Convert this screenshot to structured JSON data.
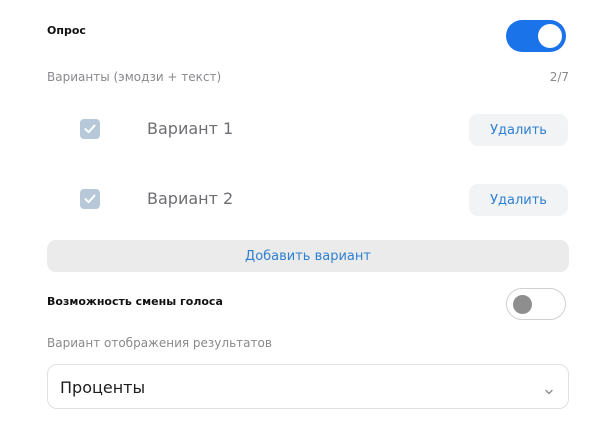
{
  "poll": {
    "title": "Опрос",
    "enabled": true
  },
  "variants": {
    "label": "Варианты (эмодзи + текст)",
    "count": "2/7",
    "items": [
      {
        "emoji": "✅",
        "text": "Вариант 1",
        "delete_label": "Удалить"
      },
      {
        "emoji": "✅",
        "text": "Вариант 2",
        "delete_label": "Удалить"
      }
    ],
    "add_label": "Добавить вариант"
  },
  "vote_change": {
    "label": "Возможность смены голоса",
    "enabled": false
  },
  "results_display": {
    "label": "Вариант отображения результатов",
    "selected": "Проценты"
  },
  "colors": {
    "accent": "#1a73e8",
    "link": "#2f80d1",
    "toggle_off_knob": "#8e8e8e"
  },
  "icons": {
    "check": "check-box-icon",
    "dropdown": "chevron-down-icon"
  }
}
